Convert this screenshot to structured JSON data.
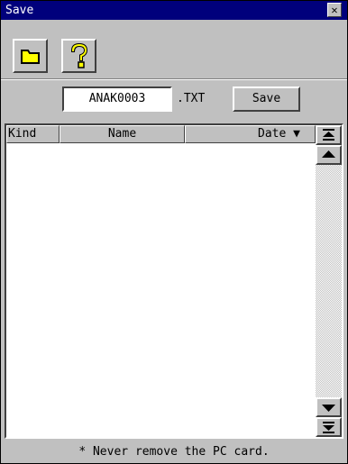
{
  "window": {
    "title": "Save"
  },
  "toolbar": {
    "open_icon": "folder-icon",
    "help_icon": "question-mark-icon"
  },
  "file": {
    "name": "ANAK0003",
    "extension": ".TXT",
    "save_label": "Save"
  },
  "list": {
    "columns": [
      {
        "label": "Kind"
      },
      {
        "label": "Name"
      },
      {
        "label": "Date"
      }
    ],
    "sort_indicator": "▼",
    "rows": []
  },
  "status": {
    "message": "* Never remove the PC card."
  },
  "colors": {
    "titlebar": "#00007c",
    "face": "#c0c0c0",
    "folder": "#ffff00"
  }
}
